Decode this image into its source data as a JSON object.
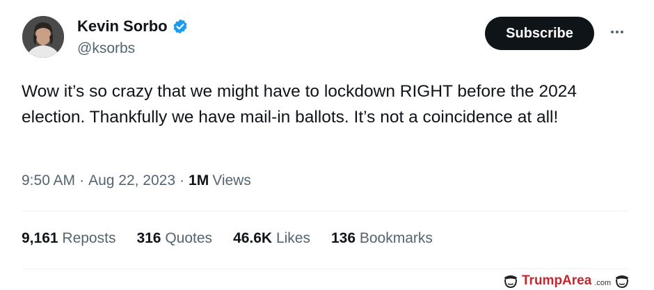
{
  "author": {
    "name": "Kevin Sorbo",
    "handle": "@ksorbs",
    "verified": true
  },
  "actions": {
    "subscribe_label": "Subscribe",
    "more_icon": "more-dots-icon"
  },
  "tweet": {
    "text": "Wow it’s so crazy that we might have to lockdown RIGHT before the 2024 election. Thankfully we have mail-in ballots. It’s not a coincidence at all!",
    "time": "9:50 AM",
    "separator": "·",
    "date": "Aug 22, 2023",
    "views_count": "1M",
    "views_label": "Views"
  },
  "stats": [
    {
      "count": "9,161",
      "label": "Reposts"
    },
    {
      "count": "316",
      "label": "Quotes"
    },
    {
      "count": "46.6K",
      "label": "Likes"
    },
    {
      "count": "136",
      "label": "Bookmarks"
    }
  ],
  "watermark": {
    "brand": "TrumpArea",
    "domain": ".com"
  },
  "colors": {
    "text": "#0f1419",
    "secondary": "#536471",
    "verified": "#1d9bf0",
    "watermark": "#c1272d"
  }
}
